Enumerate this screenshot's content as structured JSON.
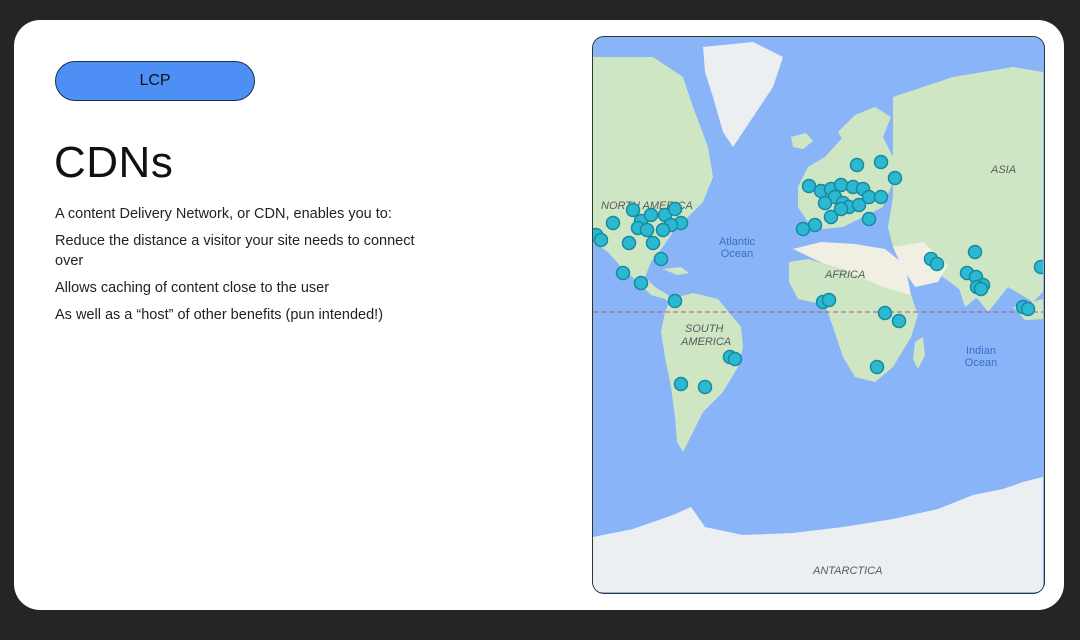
{
  "slide": {
    "tag_label": "LCP",
    "title": "CDNs",
    "bullets": [
      "A content Delivery Network, or CDN, enables you to:",
      "Reduce the distance a visitor your site needs to connect over",
      "Allows caching of content close to the user",
      "As well as a “host” of other benefits (pun intended!)"
    ]
  },
  "map": {
    "labels": {
      "north_america": "NORTH AMERICA",
      "south_america_1": "SOUTH",
      "south_america_2": "AMERICA",
      "atlantic_1": "Atlantic",
      "atlantic_2": "Ocean",
      "africa": "AFRICA",
      "asia": "ASIA",
      "indian_1": "Indian",
      "indian_2": "Ocean",
      "antarctica": "ANTARCTICA"
    },
    "colors": {
      "ocean": "#8ab4f8",
      "land": "#cfe6c4",
      "desert": "#f1efe4",
      "ice": "#eceff1",
      "marker": "#2bb8d0",
      "equator": "#b05a6a"
    },
    "marker_count": 62
  }
}
